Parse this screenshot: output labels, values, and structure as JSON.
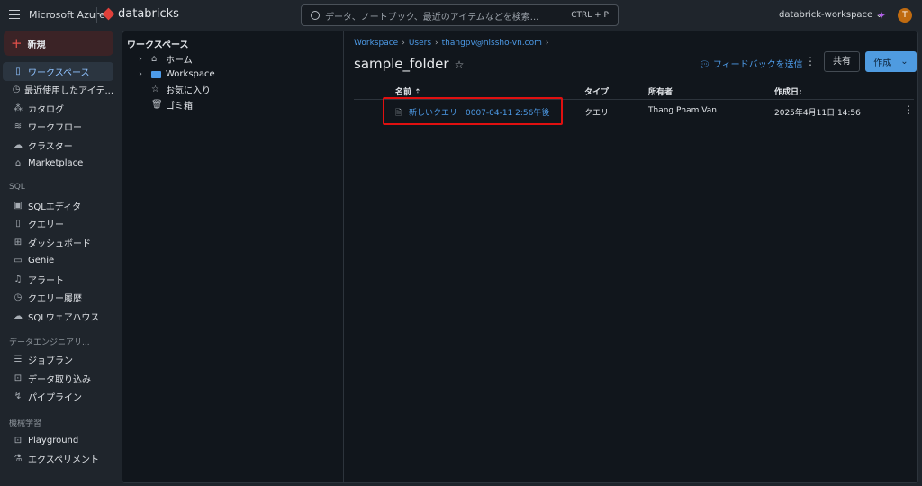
{
  "header": {
    "brand": "Microsoft Azure",
    "product": "databricks",
    "search_placeholder": "データ、ノートブック、最近のアイテムなどを検索...",
    "shortcut": "CTRL + P",
    "workspace": "databrick-workspace ⌄",
    "avatar_initial": "T"
  },
  "sidebar": {
    "new_label": "新規",
    "items": [
      {
        "icon": "▯",
        "label": "ワークスペース"
      },
      {
        "icon": "◷",
        "label": "最近使用したアイテ..."
      },
      {
        "icon": "⁂",
        "label": "カタログ"
      },
      {
        "icon": "≋",
        "label": "ワークフロー"
      },
      {
        "icon": "☁",
        "label": "クラスター"
      },
      {
        "icon": "⌂",
        "label": "Marketplace"
      }
    ],
    "sql_section": "SQL",
    "sql_items": [
      {
        "icon": "▣",
        "label": "SQLエディタ"
      },
      {
        "icon": "▯",
        "label": "クエリー"
      },
      {
        "icon": "⊞",
        "label": "ダッシュボード"
      },
      {
        "icon": "▭",
        "label": "Genie"
      },
      {
        "icon": "♫",
        "label": "アラート"
      },
      {
        "icon": "◷",
        "label": "クエリー履歴"
      },
      {
        "icon": "☁",
        "label": "SQLウェアハウス"
      }
    ],
    "de_section": "データエンジニアリ...",
    "de_items": [
      {
        "icon": "☰",
        "label": "ジョブラン"
      },
      {
        "icon": "⊡",
        "label": "データ取り込み"
      },
      {
        "icon": "↯",
        "label": "パイプライン"
      }
    ],
    "ml_section": "機械学習",
    "ml_items": [
      {
        "icon": "⊡",
        "label": "Playground"
      },
      {
        "icon": "⚗",
        "label": "エクスペリメント"
      }
    ]
  },
  "tree": {
    "title": "ワークスペース",
    "items": [
      {
        "label": "ホーム"
      },
      {
        "label": "Workspace"
      },
      {
        "label": "お気に入り"
      },
      {
        "label": "ゴミ箱"
      }
    ]
  },
  "main": {
    "breadcrumb": [
      "Workspace",
      "Users",
      "thangpv@nissho-vn.com"
    ],
    "title": "sample_folder",
    "feedback": "フィードバックを送信",
    "share": "共有",
    "create": "作成",
    "columns": [
      "名前",
      "タイプ",
      "所有者",
      "作成日:"
    ],
    "rows": [
      {
        "name": "新しいクエリー0007-04-11 2:56午後",
        "type": "クエリー",
        "owner": "Thang Pham Van",
        "created": "2025年4月11日 14:56"
      }
    ]
  }
}
